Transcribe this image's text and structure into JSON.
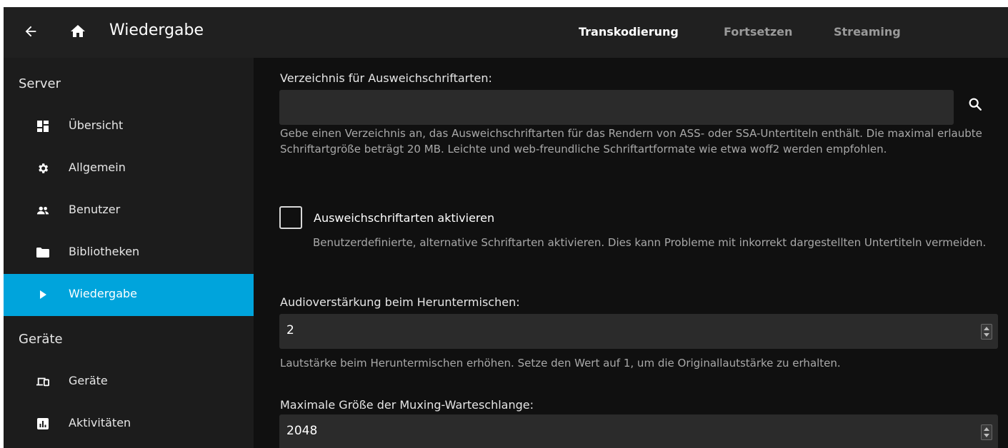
{
  "header": {
    "title": "Wiedergabe",
    "tabs": [
      "Transkodierung",
      "Fortsetzen",
      "Streaming"
    ],
    "active_tab": "Transkodierung",
    "icons": [
      "arrow-back-icon",
      "home-icon"
    ]
  },
  "sidebar": {
    "sections": [
      {
        "title": "Server",
        "items": [
          {
            "label": "Übersicht",
            "icon": "dashboard-icon"
          },
          {
            "label": "Allgemein",
            "icon": "gear-icon"
          },
          {
            "label": "Benutzer",
            "icon": "people-icon"
          },
          {
            "label": "Bibliotheken",
            "icon": "folder-icon"
          },
          {
            "label": "Wiedergabe",
            "icon": "play-icon",
            "active": true
          }
        ]
      },
      {
        "title": "Geräte",
        "items": [
          {
            "label": "Geräte",
            "icon": "devices-icon"
          },
          {
            "label": "Aktivitäten",
            "icon": "analytics-icon"
          }
        ]
      }
    ]
  },
  "main": {
    "fallback_fonts": {
      "label": "Verzeichnis für Ausweichschriftarten:",
      "value": "",
      "help": "Gebe einen Verzeichnis an, das Ausweichschriftarten für das Rendern von ASS- oder SSA-Untertiteln enthält. Die maximal erlaubte Schriftartgröße beträgt 20 MB. Leichte und web-freundliche Schriftartformate wie etwa woff2 werden empfohlen."
    },
    "enable_fallback_fonts": {
      "label": "Ausweichschriftarten aktivieren",
      "checked": false,
      "help": "Benutzerdefinierte, alternative Schriftarten aktivieren. Dies kann Probleme mit inkorrekt dargestellten Untertiteln vermeiden."
    },
    "downmix_boost": {
      "label": "Audioverstärkung beim Heruntermischen:",
      "value": "2",
      "help": "Lautstärke beim Heruntermischen erhöhen. Setze den Wert auf 1, um die Originallautstärke zu erhalten."
    },
    "muxing_queue": {
      "label": "Maximale Größe der Muxing-Warteschlange:",
      "value": "2048"
    }
  },
  "colors": {
    "accent": "#00a4dc",
    "header_bg": "#202020",
    "sidebar_bg": "#1c1c1c",
    "content_bg": "#101010",
    "input_bg": "#2b2b2b"
  }
}
